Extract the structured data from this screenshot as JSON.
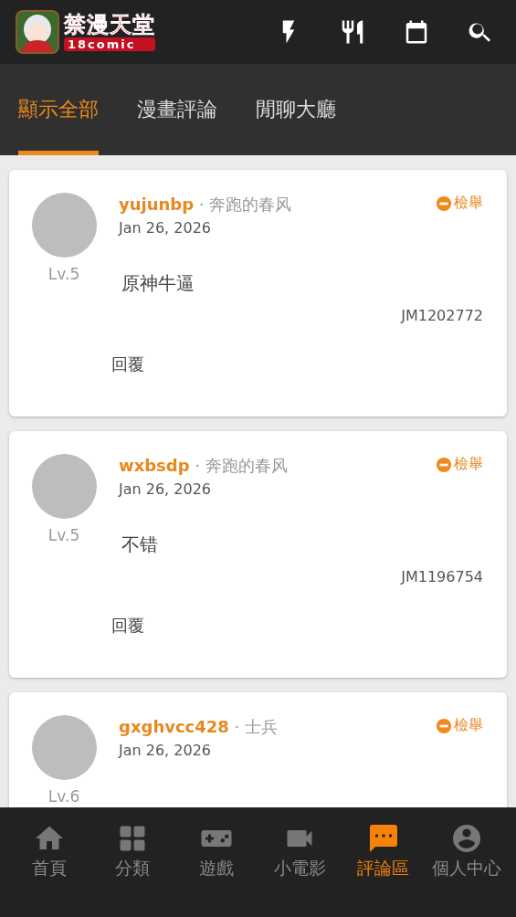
{
  "app_bar": {
    "logo_title": "禁漫天堂",
    "logo_subtitle": "18comic"
  },
  "tabs": [
    {
      "label": "顯示全部",
      "selected": true
    },
    {
      "label": "漫畫評論",
      "selected": false
    },
    {
      "label": "閒聊大廳",
      "selected": false
    }
  ],
  "comments": [
    {
      "username": "yujunbp",
      "title": "· 奔跑的春风",
      "date": "Jan 26, 2026",
      "level": "Lv.5",
      "report": "檢舉",
      "text": "原神牛逼",
      "comic_id": "JM1202772",
      "reply": "回覆"
    },
    {
      "username": "wxbsdp",
      "title": "· 奔跑的春风",
      "date": "Jan 26, 2026",
      "level": "Lv.5",
      "report": "檢舉",
      "text": "不错",
      "comic_id": "JM1196754",
      "reply": "回覆"
    },
    {
      "username": "gxghvcc428",
      "title": "· 士兵",
      "date": "Jan 26, 2026",
      "level": "Lv.6",
      "report": "檢舉"
    }
  ],
  "bottom_nav": [
    {
      "kind": "home",
      "label": "首頁",
      "selected": false
    },
    {
      "kind": "grid",
      "label": "分類",
      "selected": false
    },
    {
      "kind": "game",
      "label": "遊戲",
      "selected": false
    },
    {
      "kind": "video",
      "label": "小電影",
      "selected": false
    },
    {
      "kind": "chat",
      "label": "評論區",
      "selected": true
    },
    {
      "kind": "person",
      "label": "個人中心",
      "selected": false
    }
  ]
}
